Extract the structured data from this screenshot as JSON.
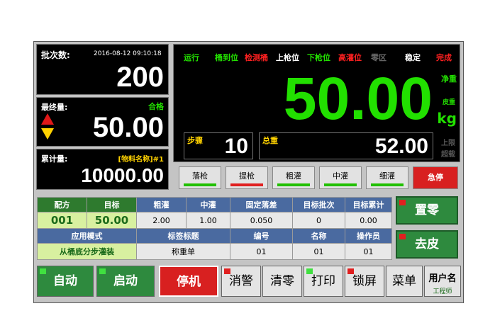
{
  "left": {
    "batch_label": "批次数:",
    "datetime": "2016-08-12  09:10:18",
    "batch_value": "200",
    "final_label": "最终量:",
    "final_status": "合格",
    "final_value": "50.00",
    "accum_label": "累计量:",
    "material": "[物料名称]#1",
    "accum_value": "10000.00"
  },
  "status": {
    "run": "运行",
    "s1": "桶到位",
    "s2": "检测桶",
    "s3": "上枪位",
    "s4": "下枪位",
    "s5": "高灌位",
    "s6": "零区",
    "stable": "稳定",
    "done": "完成"
  },
  "weight": {
    "value": "50.00",
    "net_label": "净重",
    "tare_label": "皮重",
    "unit": "kg",
    "step_label": "步骤",
    "step_value": "10",
    "gross_label": "总重",
    "gross_value": "52.00",
    "upper_label": "上限",
    "over_label": "超载"
  },
  "process_buttons": [
    "落枪",
    "提枪",
    "粗灌",
    "中灌",
    "细灌",
    "急停"
  ],
  "table": {
    "row1_headers": [
      "配方",
      "目标",
      "粗灌",
      "中灌",
      "固定落差",
      "目标批次",
      "目标累计"
    ],
    "row1_values": [
      "001",
      "50.00",
      "2.00",
      "1.00",
      "0.050",
      "0",
      "0.00"
    ],
    "row2_headers": [
      "应用模式",
      "标签标题",
      "编号",
      "名称",
      "操作员"
    ],
    "row2_values": [
      "从桶底分步灌装",
      "称重单",
      "01",
      "01",
      "01"
    ]
  },
  "side": {
    "zero": "置零",
    "tare": "去皮"
  },
  "bottom": {
    "auto": "自动",
    "start": "启动",
    "stop": "停机",
    "silence": "消警",
    "clear": "清零",
    "print": "打印",
    "lock": "锁屏",
    "menu": "菜单",
    "user_label": "用户名",
    "user_value": "工程师"
  },
  "colors": {
    "green_digits": "#22e000",
    "alarm_red": "#d82020",
    "button_green": "#2e8a3e",
    "label_yellow": "#ffd200"
  }
}
